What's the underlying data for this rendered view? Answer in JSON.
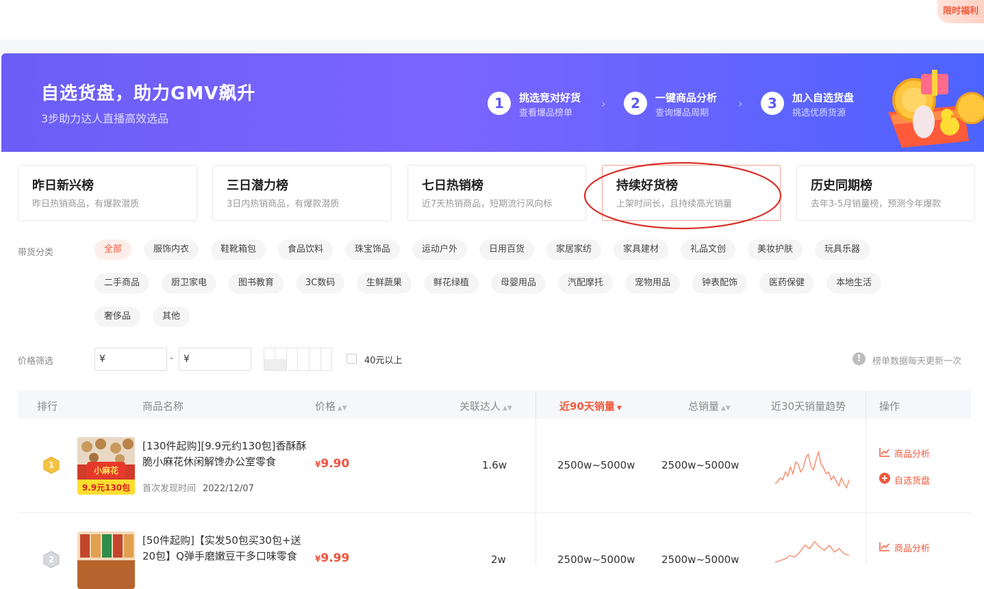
{
  "promo": {
    "label": "限时福利"
  },
  "banner": {
    "title": "自选货盘，助力GMV飙升",
    "subtitle": "3步助力达人直播高效选品",
    "steps": [
      {
        "num": "1",
        "title": "挑选竞对好货",
        "sub": "查看爆品榜单"
      },
      {
        "num": "2",
        "title": "一键商品分析",
        "sub": "查询爆品周期"
      },
      {
        "num": "3",
        "title": "加入自选货盘",
        "sub": "挑选优质货源"
      }
    ],
    "arrow": "›"
  },
  "tabs": [
    {
      "title": "昨日新兴榜",
      "sub": "昨日热销商品，有爆款潜质"
    },
    {
      "title": "三日潜力榜",
      "sub": "3日内热销商品，有爆款潜质"
    },
    {
      "title": "七日热销榜",
      "sub": "近7天热销商品，短期流行风向标"
    },
    {
      "title": "持续好货榜",
      "sub": "上架时间长，且持续高光销量"
    },
    {
      "title": "历史同期榜",
      "sub": "去年3-5月销量榜，预测今年爆款"
    }
  ],
  "active_tab": 3,
  "categories": {
    "label": "带货分类",
    "row1": [
      "全部",
      "服饰内衣",
      "鞋靴箱包",
      "食品饮料",
      "珠宝饰品",
      "运动户外",
      "日用百货",
      "家居家纺",
      "家具建材",
      "礼品文创",
      "美妆护肤",
      "玩具乐器"
    ],
    "row2": [
      "二手商品",
      "厨卫家电",
      "图书教育",
      "3C数码",
      "生鲜蔬果",
      "鲜花绿植",
      "母婴用品",
      "汽配摩托",
      "宠物用品",
      "钟表配饰",
      "医药保健",
      "本地生活"
    ],
    "row3": [
      "奢侈品",
      "其他"
    ],
    "active": "全部"
  },
  "price_filter": {
    "label": "价格筛选",
    "min_value": "¥",
    "max_value": "¥",
    "dash": "-",
    "checkbox_label": "40元以上",
    "info_icon": "!",
    "info_text": "榜单数据每天更新一次"
  },
  "table": {
    "headers": {
      "rank": "排行",
      "name": "商品名称",
      "price": "价格",
      "influencers": "关联达人",
      "sales90": "近90天销量",
      "total": "总销量",
      "trend": "近30天销量趋势",
      "ops": "操作"
    },
    "sort_icon": "▲▼",
    "sort_down": "▼",
    "rows": [
      {
        "rank": "1",
        "name": "[130件起购][9.9元约130包]香酥酥脆小麻花休闲解馋办公室零食",
        "date_label": "首次发现时间",
        "date": "2022/12/07",
        "price": "9.90",
        "influencers": "1.6w",
        "sales90": "2500w~5000w",
        "total": "2500w~5000w",
        "trend": [
          18,
          20,
          24,
          22,
          30,
          26,
          35,
          28,
          40,
          38,
          30,
          34,
          44,
          48,
          36,
          32,
          42,
          50,
          38,
          34,
          28,
          30,
          22,
          26,
          20,
          16,
          24,
          18,
          14,
          22
        ],
        "ops": [
          "商品分析",
          "自选货盘"
        ],
        "thumb_text": "小麻花",
        "thumb_banner": "9.9元130包"
      },
      {
        "rank": "2",
        "name": "[50件起购]【实发50包买30包+送20包】Q弹手磨嫩豆干多口味零食",
        "price": "9.99",
        "influencers": "2w",
        "sales90": "2500w~5000w",
        "total": "2500w~5000w",
        "trend": [
          10,
          12,
          14,
          18,
          16,
          22,
          30,
          26,
          34,
          28,
          24,
          30,
          22,
          26,
          20,
          18
        ],
        "ops": [
          "商品分析"
        ]
      }
    ],
    "currency": "¥"
  },
  "colors": {
    "accent": "#f05a3c",
    "banner_start": "#6a5ef5",
    "banner_end": "#4d63ff"
  }
}
